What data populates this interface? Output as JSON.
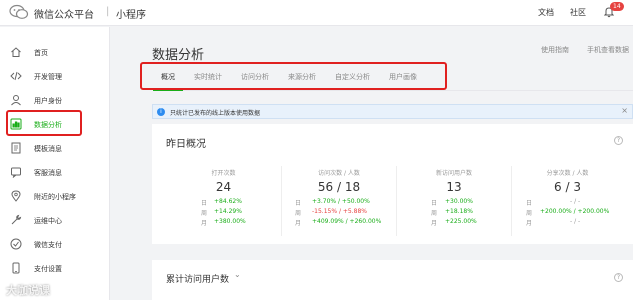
{
  "topbar": {
    "brand": "微信公众平台",
    "separator": "|",
    "app_name": "小程序",
    "doc_link": "文档",
    "community_link": "社区",
    "notification_count": "14"
  },
  "sidebar": {
    "items": [
      {
        "label": "首页",
        "icon": "home-icon"
      },
      {
        "label": "开发管理",
        "icon": "code-icon"
      },
      {
        "label": "用户身份",
        "icon": "user-icon"
      },
      {
        "label": "数据分析",
        "icon": "chart-icon"
      },
      {
        "label": "模板消息",
        "icon": "document-icon"
      },
      {
        "label": "客服消息",
        "icon": "customer-service-icon"
      },
      {
        "label": "附近的小程序",
        "icon": "location-icon"
      },
      {
        "label": "运维中心",
        "icon": "wrench-icon"
      },
      {
        "label": "微信支付",
        "icon": "pay-icon"
      },
      {
        "label": "支付设置",
        "icon": "phone-icon"
      }
    ],
    "active_index": 3
  },
  "main": {
    "title": "数据分析",
    "help_links": [
      "使用指南",
      "手机查看数据"
    ],
    "tabs": [
      "概况",
      "实时统计",
      "访问分析",
      "来源分析",
      "自定义分析",
      "用户画像"
    ],
    "active_tab": 0,
    "notice": "只统计已发布的线上版本使用数据",
    "notice_close": "×",
    "overview": {
      "title": "昨日概况",
      "row_keys": [
        "日",
        "周",
        "月"
      ],
      "metrics": [
        {
          "label": "打开次数",
          "value": "24",
          "rows": [
            "+84.62%",
            "+14.29%",
            "+380.00%"
          ]
        },
        {
          "label": "访问次数 / 人数",
          "value": "56 / 18",
          "rows": [
            "+3.70% / +50.00%",
            "-15.15% / +5.88%",
            "+409.09% / +260.00%"
          ]
        },
        {
          "label": "新访问用户数",
          "value": "13",
          "rows": [
            "+30.00%",
            "+18.18%",
            "+225.00%"
          ]
        },
        {
          "label": "分享次数 / 人数",
          "value": "6 / 3",
          "rows": [
            "- / -",
            "+200.00% / +200.00%",
            "- / -"
          ]
        }
      ]
    },
    "cumulative": {
      "title": "累计访问用户数",
      "chevron": "⌄"
    }
  },
  "watermark": "大咖说课",
  "colors": {
    "accent": "#1aad19",
    "negative": "#e64340",
    "highlight_box": "#e02020"
  }
}
